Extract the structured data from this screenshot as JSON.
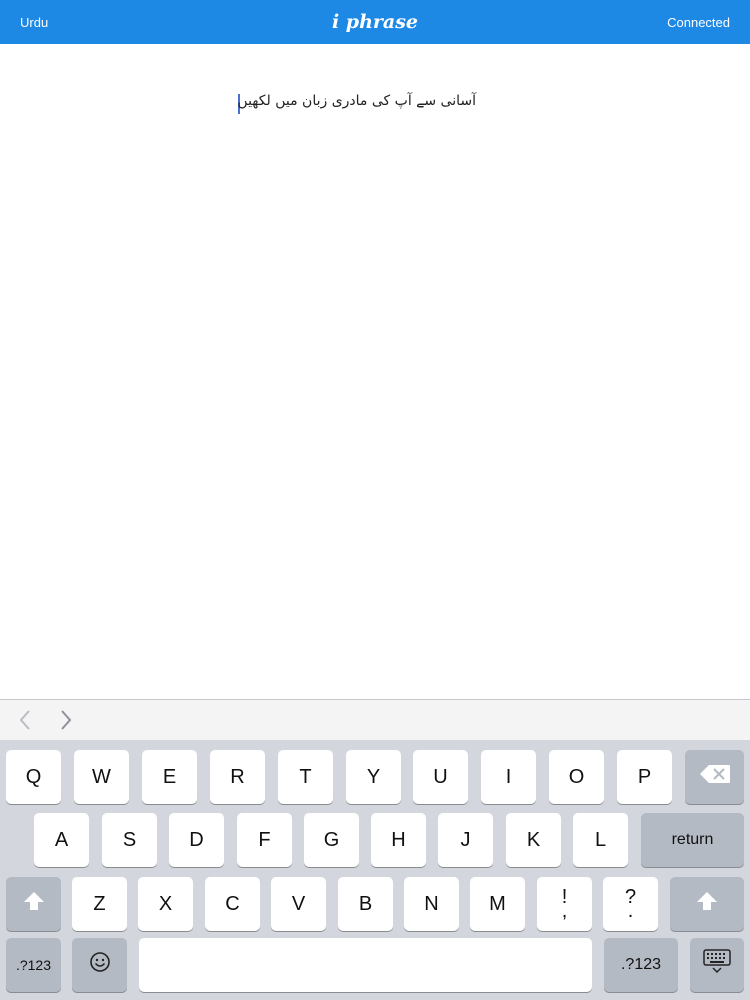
{
  "header": {
    "language": "Urdu",
    "app_title": "i phrase",
    "status": "Connected",
    "bar_color": "#1e88e5"
  },
  "editor": {
    "text": "آسانی سے آپ کی مادری زبان میں لکھیں"
  },
  "accessory_bar": {
    "back_icon": "chevron-left-icon",
    "forward_icon": "chevron-right-icon"
  },
  "keyboard": {
    "row1": [
      "Q",
      "W",
      "E",
      "R",
      "T",
      "Y",
      "U",
      "I",
      "O",
      "P"
    ],
    "row2": [
      "A",
      "S",
      "D",
      "F",
      "G",
      "H",
      "J",
      "K",
      "L"
    ],
    "row3": [
      "Z",
      "X",
      "C",
      "V",
      "B",
      "N",
      "M"
    ],
    "punct1": {
      "top": "!",
      "bottom": ","
    },
    "punct2": {
      "top": "?",
      "bottom": "."
    },
    "return_label": "return",
    "numbers_left_label": ".?123",
    "numbers_right_label": ".?123",
    "delete_icon": "backspace-icon",
    "shift_icon": "shift-icon",
    "emoji_icon": "emoji-icon",
    "hide_keyboard_icon": "keyboard-dismiss-icon"
  }
}
